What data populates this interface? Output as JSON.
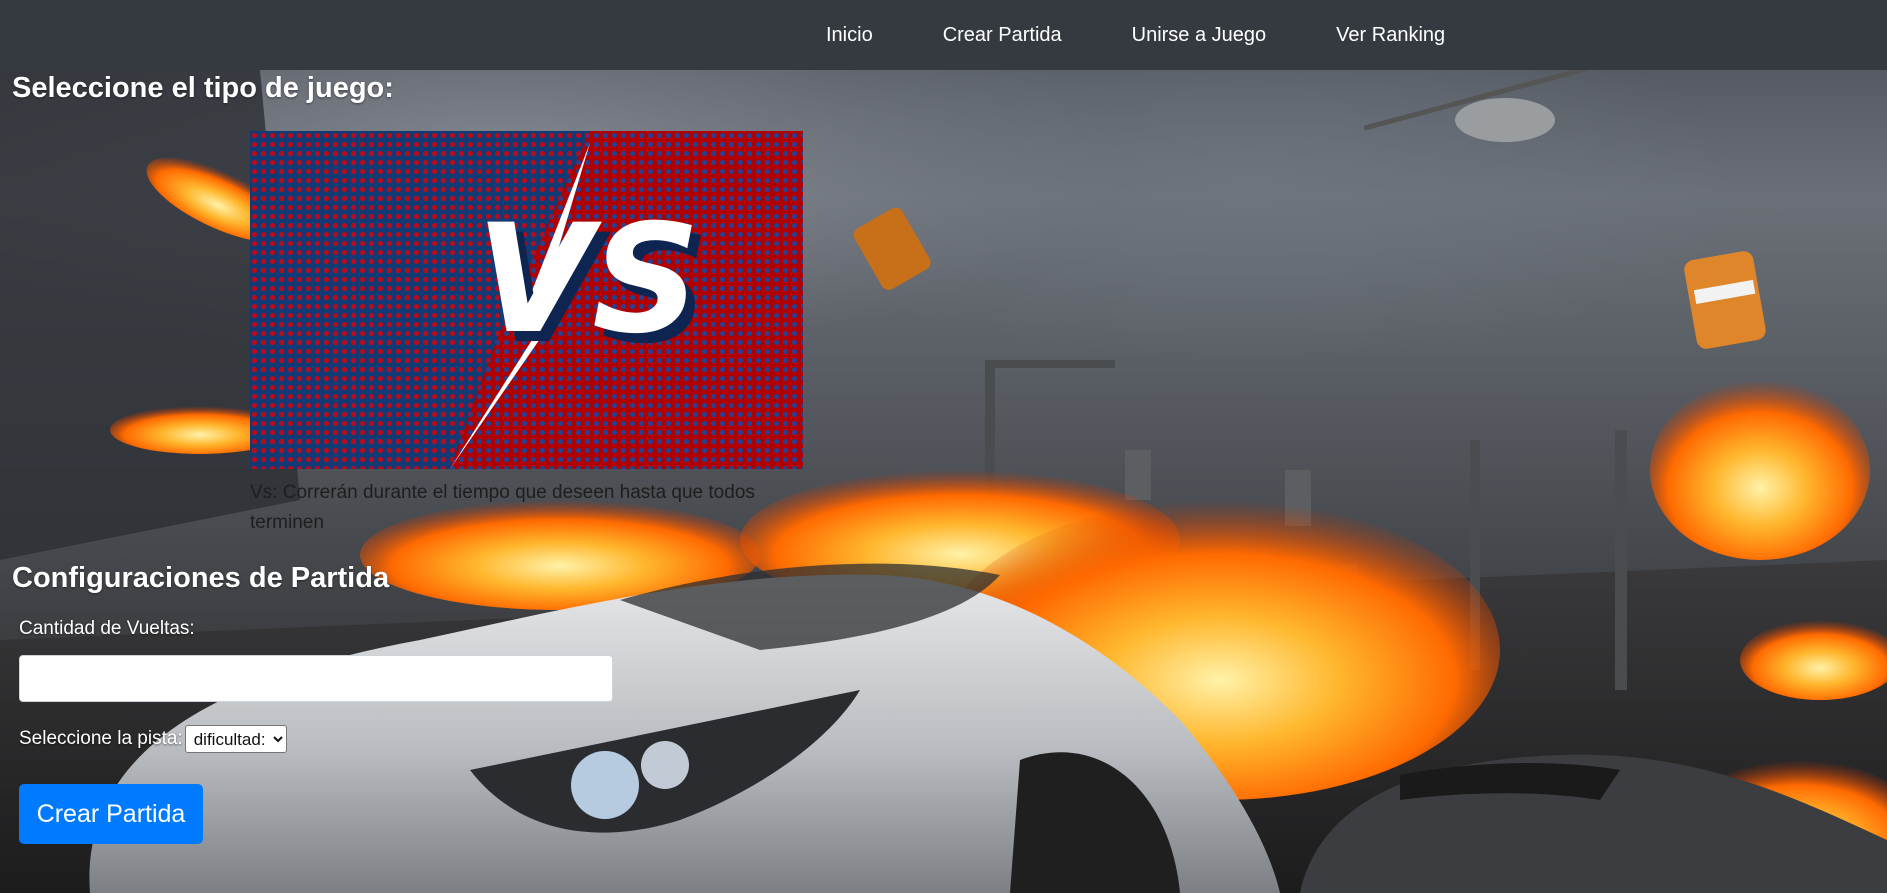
{
  "navbar": {
    "items": [
      {
        "label": "Inicio"
      },
      {
        "label": "Crear Partida"
      },
      {
        "label": "Unirse a Juego"
      },
      {
        "label": "Ver Ranking"
      }
    ]
  },
  "game_type": {
    "title": "Seleccione el tipo de juego:",
    "card": {
      "image_text": "VS",
      "description": "Vs: Correrán durante el tiempo que deseen hasta que todos terminen",
      "colors": {
        "left": "#123a74",
        "right": "#b00000"
      }
    }
  },
  "config": {
    "title": "Configuraciones de Partida",
    "laps_label": "Cantidad de Vueltas:",
    "laps_value": "",
    "track_label": "Seleccione la pista:",
    "difficulty_selected": "dificultad:",
    "create_button": "Crear Partida"
  },
  "colors": {
    "navbar_bg": "#343a40",
    "primary_button": "#007bff"
  }
}
